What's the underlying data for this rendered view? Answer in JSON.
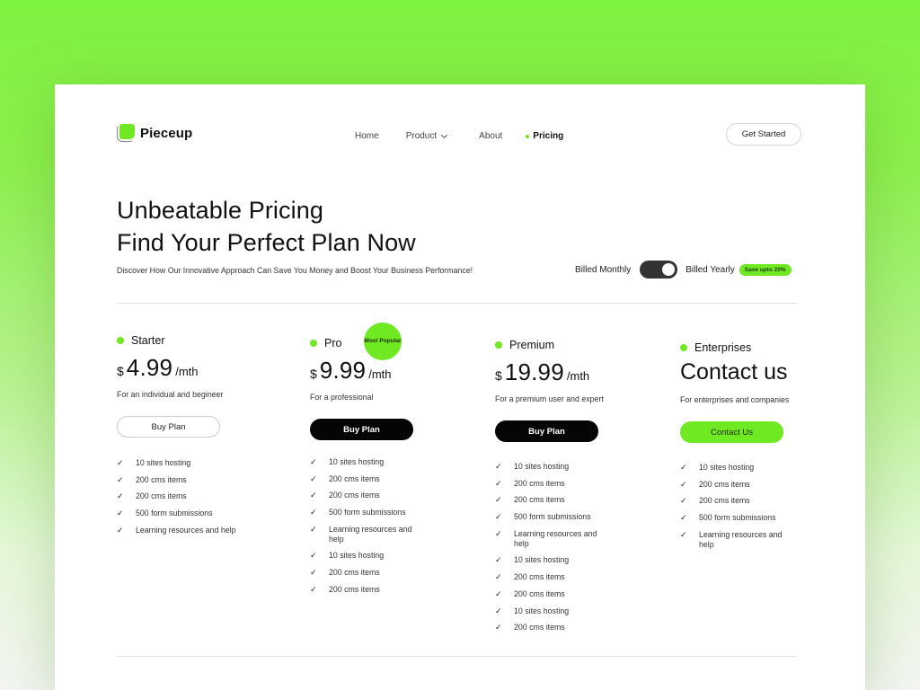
{
  "brand": {
    "name": "Pieceup",
    "accent_color": "#6ee922"
  },
  "nav": {
    "items": [
      {
        "label": "Home"
      },
      {
        "label": "Product"
      },
      {
        "label": "About"
      },
      {
        "label": "Pricing"
      }
    ],
    "cta_label": "Get Started"
  },
  "hero": {
    "title_line1": "Unbeatable Pricing",
    "title_line2": "Find Your Perfect Plan Now",
    "subtitle": "Discover How Our Innovative Approach Can Save You Money and Boost Your Business Performance!"
  },
  "billing": {
    "monthly_label": "Billed Monthly",
    "yearly_label": "Billed Yearly",
    "save_badge": "Save upto 20%",
    "selected": "yearly"
  },
  "plans": [
    {
      "name": "Starter",
      "currency": "$",
      "price": "4.99",
      "period": "/mth",
      "description": "For an individual and begineer",
      "button_label": "Buy Plan",
      "features": [
        "10 sites hosting",
        "200 cms items",
        "200 cms items",
        "500 form submissions",
        "Learning resources and help"
      ]
    },
    {
      "name": "Pro",
      "badge": "Most Popular",
      "currency": "$",
      "price": "9.99",
      "period": "/mth",
      "description": "For a professional",
      "button_label": "Buy Plan",
      "features": [
        "10 sites hosting",
        "200 cms items",
        "200 cms items",
        "500 form submissions",
        "Learning resources and help",
        "10 sites hosting",
        "200 cms items",
        "200 cms items"
      ]
    },
    {
      "name": "Premium",
      "currency": "$",
      "price": "19.99",
      "period": "/mth",
      "description": "For a premium user and expert",
      "button_label": "Buy Plan",
      "features": [
        "10 sites hosting",
        "200 cms items",
        "200 cms items",
        "500 form submissions",
        "Learning resources and help",
        "10 sites hosting",
        "200 cms items",
        "200 cms items",
        "10 sites hosting",
        "200 cms items"
      ]
    },
    {
      "name": "Enterprises",
      "headline": "Contact us",
      "description": "For enterprises and companies",
      "button_label": "Contact Us",
      "features": [
        "10 sites hosting",
        "200 cms items",
        "200 cms items",
        "500 form submissions",
        "Learning resources and help"
      ]
    }
  ],
  "icons": {
    "check": "✓"
  }
}
